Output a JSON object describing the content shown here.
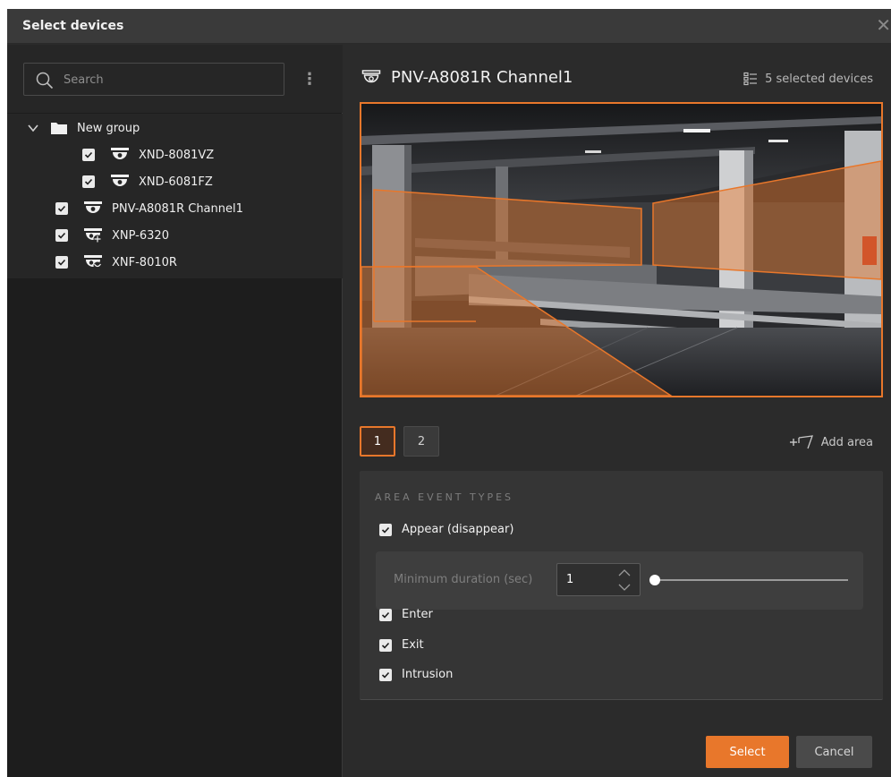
{
  "dialog": {
    "title": "Select devices"
  },
  "search": {
    "placeholder": "Search"
  },
  "tree": {
    "group_label": "New group",
    "items": [
      {
        "label": "XND-8081VZ",
        "checked": true,
        "icon": "dome-camera-icon"
      },
      {
        "label": "XND-6081FZ",
        "checked": true,
        "icon": "dome-camera-icon"
      },
      {
        "label": "PNV-A8081R Channel1",
        "checked": true,
        "icon": "dome-camera-icon"
      },
      {
        "label": "XNP-6320",
        "checked": true,
        "icon": "ptz-camera-icon"
      },
      {
        "label": "XNF-8010R",
        "checked": true,
        "icon": "fisheye-camera-icon"
      }
    ]
  },
  "device": {
    "name": "PNV-A8081R Channel1",
    "selected_count": "5 selected devices"
  },
  "area_tabs": [
    {
      "label": "1",
      "active": true
    },
    {
      "label": "2",
      "active": false
    }
  ],
  "add_area_label": "Add area",
  "events": {
    "heading": "AREA EVENT TYPES",
    "items": [
      {
        "label": "Appear (disappear)",
        "checked": true
      },
      {
        "label": "Enter",
        "checked": true
      },
      {
        "label": "Exit",
        "checked": true
      },
      {
        "label": "Intrusion",
        "checked": true
      }
    ],
    "min_duration_label": "Minimum duration (sec)",
    "min_duration_value": "1"
  },
  "buttons": {
    "select": "Select",
    "cancel": "Cancel"
  },
  "colors": {
    "accent": "#e8772b",
    "panel": "#2b2b2b",
    "tree_bg": "#262626"
  }
}
